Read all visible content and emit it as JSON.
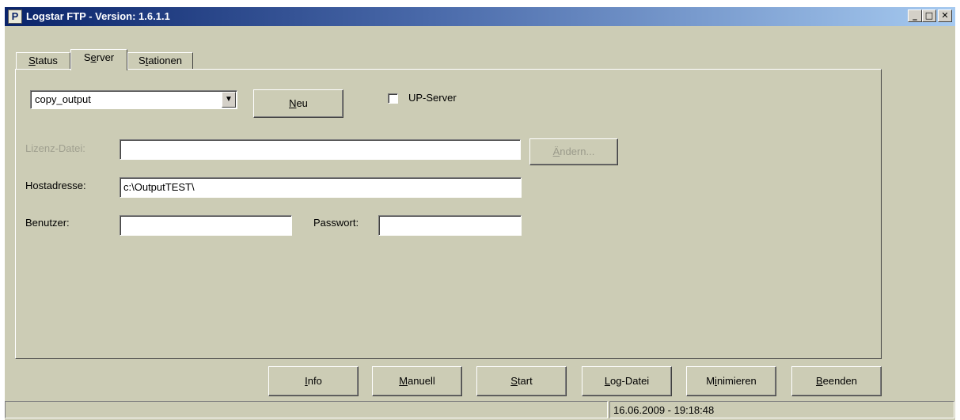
{
  "window": {
    "title": "Logstar FTP - Version: 1.6.1.1",
    "icon_letter": "P",
    "caption_buttons": {
      "minimize": "_",
      "maximize": "□",
      "close": "✕"
    }
  },
  "tabs": [
    {
      "label": "Status",
      "mnemonic": "S",
      "rest": "tatus",
      "active": false
    },
    {
      "label": "Server",
      "prefix": "S",
      "mnemonic": "e",
      "rest": "rver",
      "active": true
    },
    {
      "label": "Stationen",
      "prefix": "S",
      "mnemonic": "t",
      "rest": "ationen",
      "active": false
    }
  ],
  "server": {
    "selected_server": "copy_output",
    "new_button": {
      "mnemonic": "N",
      "rest": "eu"
    },
    "up_server_label": "UP-Server",
    "up_server_checked": false,
    "license_label": "Lizenz-Datei:",
    "license_value": "",
    "change_button": {
      "mnemonic": "Ä",
      "rest": "ndern..."
    },
    "host_label": "Hostadresse:",
    "host_value": "c:\\OutputTEST\\",
    "user_label": "Benutzer:",
    "user_value": "",
    "password_label": "Passwort:",
    "password_value": ""
  },
  "buttons": {
    "info": {
      "mnemonic": "I",
      "rest": "nfo"
    },
    "manual": {
      "mnemonic": "M",
      "rest": "anuell"
    },
    "start": {
      "mnemonic": "S",
      "rest": "tart"
    },
    "log": {
      "mnemonic": "L",
      "rest": "og-Datei"
    },
    "minimize": {
      "prefix": "M",
      "mnemonic": "i",
      "rest": "nimieren"
    },
    "quit": {
      "mnemonic": "B",
      "rest": "eenden"
    }
  },
  "status": {
    "left": "",
    "datetime": "16.06.2009 - 19:18:48"
  },
  "colors": {
    "face": "#ccccb5",
    "title_start": "#0a246a",
    "title_end": "#a6caf0"
  }
}
